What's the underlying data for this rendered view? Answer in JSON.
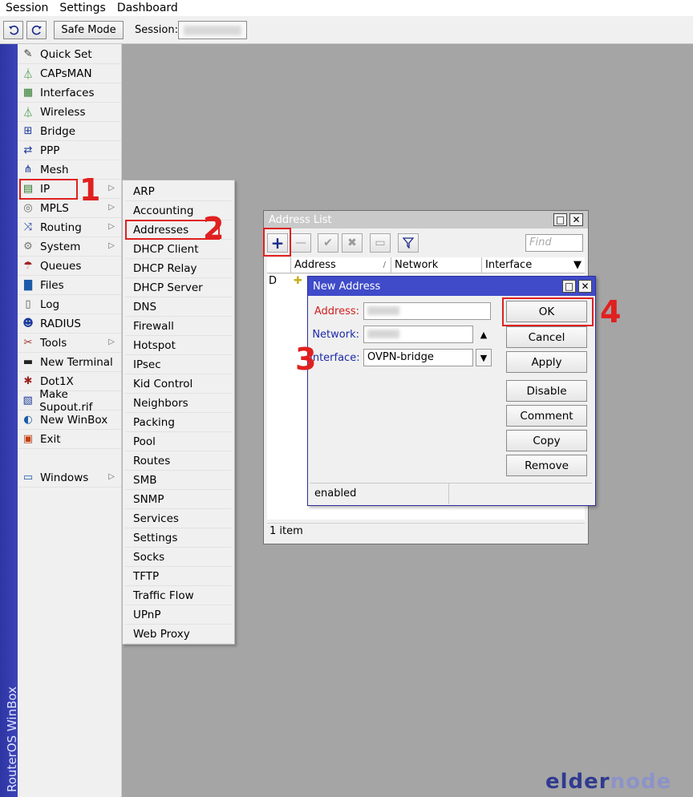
{
  "menubar": {
    "items": [
      "Session",
      "Settings",
      "Dashboard"
    ]
  },
  "toolbar": {
    "safe_mode": "Safe Mode",
    "session_label": "Session:"
  },
  "sidebar_title": "RouterOS WinBox",
  "main_menu": [
    {
      "label": "Quick Set",
      "icon": "wand-icon",
      "submenu": false
    },
    {
      "label": "CAPsMAN",
      "icon": "antenna-icon",
      "submenu": false
    },
    {
      "label": "Interfaces",
      "icon": "ethernet-port-icon",
      "submenu": false
    },
    {
      "label": "Wireless",
      "icon": "antenna-icon",
      "submenu": false
    },
    {
      "label": "Bridge",
      "icon": "bridge-icon",
      "submenu": false
    },
    {
      "label": "PPP",
      "icon": "ppp-icon",
      "submenu": false
    },
    {
      "label": "Mesh",
      "icon": "mesh-icon",
      "submenu": false
    },
    {
      "label": "IP",
      "icon": "ip-icon",
      "submenu": true
    },
    {
      "label": "MPLS",
      "icon": "mpls-icon",
      "submenu": true
    },
    {
      "label": "Routing",
      "icon": "routing-icon",
      "submenu": true
    },
    {
      "label": "System",
      "icon": "gear-icon",
      "submenu": true
    },
    {
      "label": "Queues",
      "icon": "queues-icon",
      "submenu": false
    },
    {
      "label": "Files",
      "icon": "folder-icon",
      "submenu": false
    },
    {
      "label": "Log",
      "icon": "log-icon",
      "submenu": false
    },
    {
      "label": "RADIUS",
      "icon": "users-icon",
      "submenu": false
    },
    {
      "label": "Tools",
      "icon": "tools-icon",
      "submenu": true
    },
    {
      "label": "New Terminal",
      "icon": "terminal-icon",
      "submenu": false
    },
    {
      "label": "Dot1X",
      "icon": "dot1x-icon",
      "submenu": false
    },
    {
      "label": "Make Supout.rif",
      "icon": "document-icon",
      "submenu": false
    },
    {
      "label": "New WinBox",
      "icon": "winbox-icon",
      "submenu": false
    },
    {
      "label": "Exit",
      "icon": "exit-icon",
      "submenu": false
    }
  ],
  "windows_item": {
    "label": "Windows",
    "icon": "monitor-icon"
  },
  "ip_submenu": [
    "ARP",
    "Accounting",
    "Addresses",
    "DHCP Client",
    "DHCP Relay",
    "DHCP Server",
    "DNS",
    "Firewall",
    "Hotspot",
    "IPsec",
    "Kid Control",
    "Neighbors",
    "Packing",
    "Pool",
    "Routes",
    "SMB",
    "SNMP",
    "Services",
    "Settings",
    "Socks",
    "TFTP",
    "Traffic Flow",
    "UPnP",
    "Web Proxy"
  ],
  "annotations": {
    "step1": "1",
    "step2": "2",
    "step3": "3",
    "step4": "4"
  },
  "address_list": {
    "title": "Address List",
    "find_placeholder": "Find",
    "columns": [
      "Address",
      "Network",
      "Interface"
    ],
    "sort_mark": "/",
    "rows": [
      {
        "flag": "D"
      }
    ],
    "status": "1 item"
  },
  "new_address": {
    "title": "New Address",
    "address_label": "Address:",
    "network_label": "Network:",
    "interface_label": "Interface:",
    "interface_value": "OVPN-bridge",
    "buttons": [
      "OK",
      "Cancel",
      "Apply",
      "Disable",
      "Comment",
      "Copy",
      "Remove"
    ],
    "status": "enabled"
  },
  "watermark": {
    "part1": "elder",
    "part2": "node"
  },
  "colors": {
    "sidebar_band": "#3b44b8",
    "dialog_title": "#3f4bc9",
    "annotation": "#e02020"
  }
}
